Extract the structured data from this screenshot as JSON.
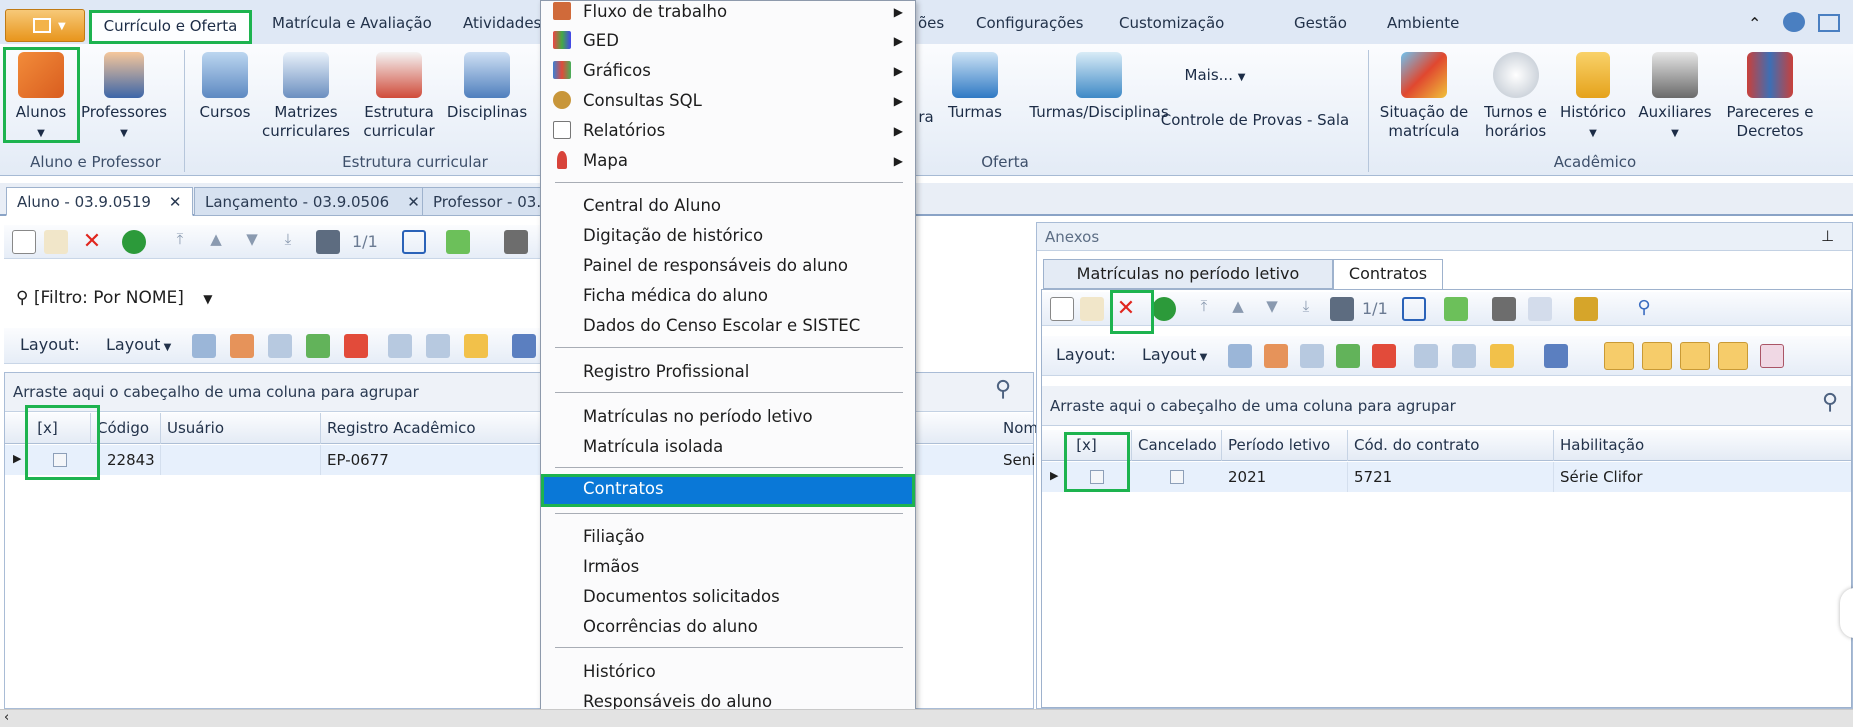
{
  "ribbon": {
    "tabs": [
      "Currículo e Oferta",
      "Matrícula e Avaliação",
      "Atividades",
      "ões",
      "Configurações",
      "Customização",
      "Gestão",
      "Ambiente"
    ],
    "buttons": {
      "alunos": "Alunos",
      "professores": "Professores",
      "cursos": "Cursos",
      "matrizes": "Matrizes curriculares",
      "estrutura": "Estrutura curricular",
      "disciplinas": "Disciplinas",
      "ra": "ra",
      "turmas": "Turmas",
      "turmas_disc": "Turmas/Disciplinas",
      "mais": "Mais...",
      "controle": "Controle de Provas - Sala",
      "situacao": "Situação de matrícula",
      "turnos": "Turnos e horários",
      "historico": "Histórico",
      "auxiliares": "Auxiliares",
      "pareceres": "Pareceres e Decretos"
    },
    "groups": {
      "aluno_prof": "Aluno e Professor",
      "estrutura": "Estrutura curricular",
      "oferta": "Oferta",
      "academico": "Acadêmico"
    }
  },
  "doc_tabs": [
    {
      "label": "Aluno - 03.9.0519"
    },
    {
      "label": "Lançamento - 03.9.0506"
    },
    {
      "label": "Professor - 03."
    }
  ],
  "left": {
    "filter": "[Filtro: Por NOME]",
    "layout_label": "Layout:",
    "layout_btn": "Layout",
    "page": "1/1",
    "group_hint": "Arraste aqui o cabeçalho de uma coluna para agrupar",
    "columns": [
      "[x]",
      "Código",
      "Usuário",
      "Registro Acadêmico",
      "Nom"
    ],
    "row": {
      "codigo": "22843",
      "usuario": "",
      "registro": "EP-0677",
      "nome": "Seni"
    }
  },
  "anexos": {
    "title": "Anexos",
    "tabs": [
      "Matrículas no período letivo",
      "Contratos"
    ],
    "layout_label": "Layout:",
    "layout_btn": "Layout",
    "page": "1/1",
    "group_hint": "Arraste aqui o cabeçalho de uma coluna para agrupar",
    "columns": [
      "[x]",
      "Cancelado",
      "Período letivo",
      "Cód. do contrato",
      "Habilitação"
    ],
    "row": {
      "periodo": "2021",
      "contrato": "5721",
      "habilitacao": "Série Clifor"
    }
  },
  "menu": {
    "submenus": [
      "Fluxo de trabalho",
      "GED",
      "Gráficos",
      "Consultas SQL",
      "Relatórios",
      "Mapa"
    ],
    "group1": [
      "Central do Aluno",
      "Digitação de histórico",
      "Painel de responsáveis do aluno",
      "Ficha médica do aluno",
      "Dados do Censo Escolar e SISTEC"
    ],
    "group2": [
      "Registro Profissional"
    ],
    "group3": [
      "Matrículas no período letivo",
      "Matrícula isolada"
    ],
    "selected": "Contratos",
    "group4": [
      "Filiação",
      "Irmãos",
      "Documentos solicitados",
      "Ocorrências do aluno"
    ],
    "group5": [
      "Histórico",
      "Responsáveis do aluno"
    ]
  },
  "colors": {
    "highlight": "#1db34f",
    "selection": "#0a78d7",
    "ribbon_bg": "#dfe8f5"
  }
}
